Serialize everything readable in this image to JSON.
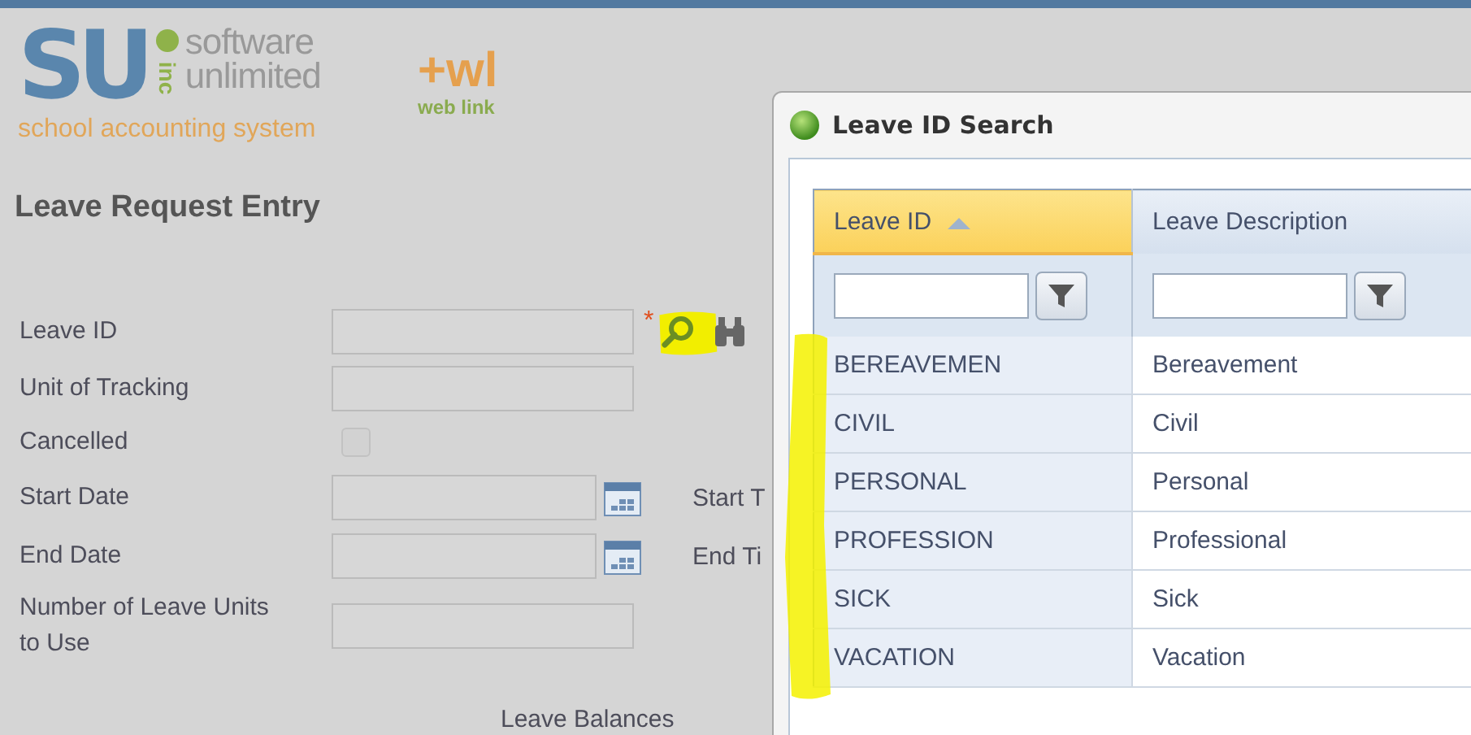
{
  "logo": {
    "mark": "SU",
    "suffix": "inc",
    "name_lines": [
      "software",
      "unlimited"
    ],
    "tagline": "school accounting system"
  },
  "weblink": {
    "mark": "+wl",
    "label": "web link"
  },
  "page_title": "Leave Request Entry",
  "form": [
    {
      "kind": "lookup",
      "label": "Leave ID",
      "required_mark": "*"
    },
    {
      "kind": "text",
      "label": "Unit of Tracking"
    },
    {
      "kind": "checkbox",
      "label": "Cancelled",
      "checked": false
    },
    {
      "kind": "date",
      "label": "Start Date",
      "side_label": "Start T"
    },
    {
      "kind": "date",
      "label": "End Date",
      "side_label": "End Ti"
    },
    {
      "kind": "text",
      "label": "Number of Leave Units to Use"
    }
  ],
  "section_title": "Leave Balances",
  "dialog": {
    "title": "Leave ID Search",
    "columns": [
      {
        "label": "Leave ID",
        "sorted": true
      },
      {
        "label": "Leave Description",
        "sorted": false
      }
    ],
    "rows": [
      [
        "BEREAVEMEN",
        "Bereavement"
      ],
      [
        "CIVIL",
        "Civil"
      ],
      [
        "PERSONAL",
        "Personal"
      ],
      [
        "PROFESSION",
        "Professional"
      ],
      [
        "SICK",
        "Sick"
      ],
      [
        "VACATION",
        "Vacation"
      ]
    ]
  }
}
